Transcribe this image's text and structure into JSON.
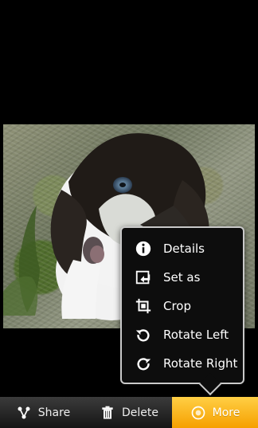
{
  "menu": {
    "items": [
      {
        "label": "Details",
        "icon": "info-icon"
      },
      {
        "label": "Set as",
        "icon": "set-as-icon"
      },
      {
        "label": "Crop",
        "icon": "crop-icon"
      },
      {
        "label": "Rotate Left",
        "icon": "rotate-left-icon"
      },
      {
        "label": "Rotate Right",
        "icon": "rotate-right-icon"
      }
    ]
  },
  "toolbar": {
    "share_label": "Share",
    "delete_label": "Delete",
    "more_label": "More"
  },
  "colors": {
    "accent": "#f7b21a",
    "menu_border": "#c9c9c9",
    "toolbar_dark": "#1d1d1d"
  }
}
